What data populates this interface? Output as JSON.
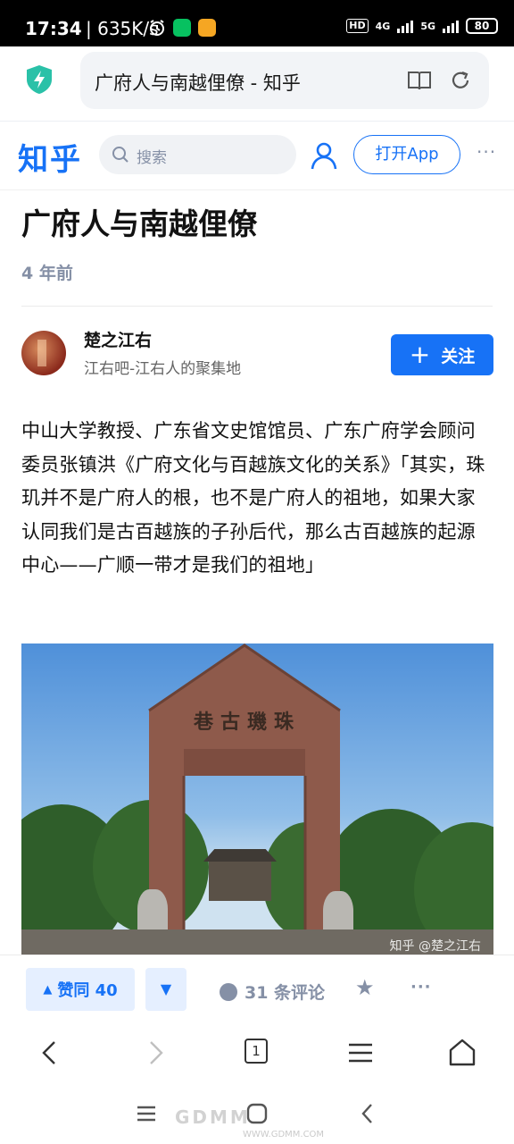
{
  "status_bar": {
    "time": "17:34",
    "speed": "| 635K/s",
    "hd_badge": "HD",
    "net_1": "4G",
    "net_2": "5G",
    "battery": "80"
  },
  "browser": {
    "page_title": "广府人与南越俚僚 - 知乎",
    "icons": [
      "shield-lightning-icon",
      "reader-mode-icon",
      "refresh-icon"
    ]
  },
  "zhihu_header": {
    "logo": "知乎",
    "search_placeholder": "搜索",
    "open_app_label": "打开App",
    "more_label": "···"
  },
  "article": {
    "title": "广府人与南越俚僚",
    "time": "4 年前",
    "author_name": "楚之江右",
    "author_bio": "江右吧-江右人的聚集地",
    "follow_label": "关注",
    "follow_icon": "+",
    "paragraph": "中山大学教授、广东省文史馆馆员、广东广府学会顾问委员张镇洪《广府文化与百越族文化的关系》「其实，珠玑并不是广府人的根，也不是广府人的祖地，如果大家认同我们是古百越族的子孙后代，那么古百越族的起源中心——广顺一带才是我们的祖地」",
    "image_caption": "知乎 @楚之江右",
    "gate_inscription": "巷古璣珠"
  },
  "action_bar": {
    "vote_label": "赞同 40",
    "vote_up_icon": "▲",
    "vote_down_icon": "▼",
    "comments_label": "31 条评论",
    "star_icon": "★",
    "more_label": "···"
  },
  "browser_nav": {
    "tab_count": "1"
  },
  "system_nav": {
    "watermark": "GDMM",
    "watermark_sub": "WWW.GDMM.COM"
  },
  "colors": {
    "accent": "#1772f6",
    "muted": "#8590a6",
    "vote_bg": "#e5efff"
  }
}
